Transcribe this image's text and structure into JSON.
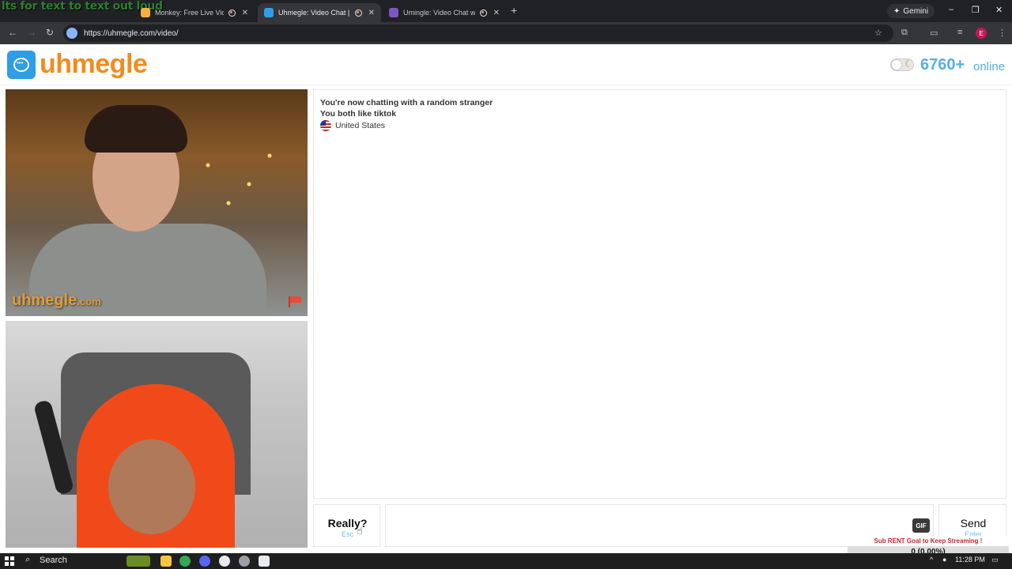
{
  "browser": {
    "overlay_text": "lts for text to text out loud",
    "tabs": [
      {
        "title": "Monkey: Free Live Video Ch",
        "active": false
      },
      {
        "title": "Uhmegle: Video Chat | Ran",
        "active": true
      },
      {
        "title": "Umingle: Video Chat with S",
        "active": false
      }
    ],
    "new_tab": "+",
    "gemini_label": "Gemini",
    "url": "https://uhmegle.com/video/"
  },
  "site": {
    "logo_text": "uhmegle",
    "online_count": "6760+",
    "online_label": "online",
    "theme_toggle_on": false
  },
  "video": {
    "watermark": "uhmegle",
    "watermark_suffix": ".com"
  },
  "chat": {
    "line1": "You're now chatting with a random stranger",
    "line2": "You both like tiktok",
    "country": "United States"
  },
  "controls": {
    "stop_label": "Really?",
    "stop_key": "Esc",
    "input_value": "",
    "gif_label": "GIF",
    "send_label": "Send",
    "send_key": "Enter"
  },
  "stream_overlay": {
    "goal_text": "Sub RENT Goal to Keep Streaming !",
    "goal_value": "0 (0.00%)",
    "goal_fraction": 0.0
  },
  "taskbar": {
    "search_label": "Search",
    "time": "11:28 PM"
  },
  "colors": {
    "brand_orange": "#f28c1e",
    "brand_blue": "#2e9ee6",
    "online_blue": "#57aee6"
  }
}
